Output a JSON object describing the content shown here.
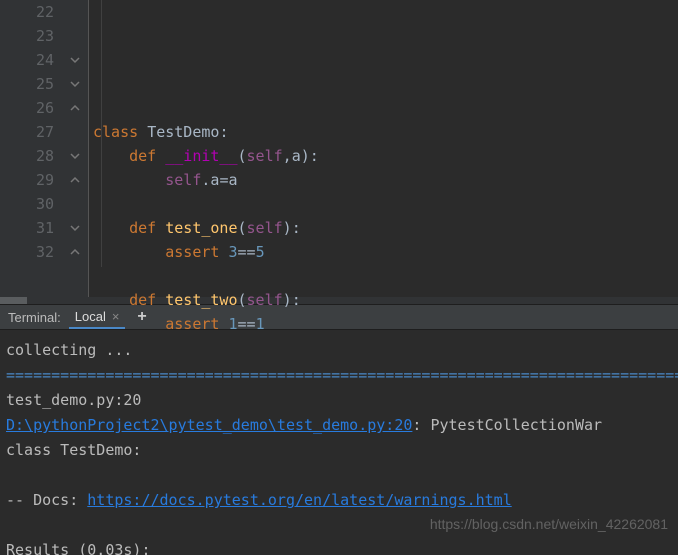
{
  "editor": {
    "lines": [
      {
        "num": 22,
        "fold": null,
        "tokens": []
      },
      {
        "num": 23,
        "fold": null,
        "tokens": []
      },
      {
        "num": 24,
        "fold": "down",
        "tokens": [
          {
            "t": "class ",
            "c": "kw-orange"
          },
          {
            "t": "TestDemo",
            "c": "punct"
          },
          {
            "t": ":",
            "c": "punct"
          }
        ]
      },
      {
        "num": 25,
        "fold": "down",
        "tokens": [
          {
            "t": "    ",
            "c": ""
          },
          {
            "t": "def ",
            "c": "kw-orange"
          },
          {
            "t": "__init__",
            "c": "fn-magic"
          },
          {
            "t": "(",
            "c": "punct"
          },
          {
            "t": "self",
            "c": "self"
          },
          {
            "t": ",",
            "c": "op"
          },
          {
            "t": "a",
            "c": "punct"
          },
          {
            "t": ")",
            "c": "punct"
          },
          {
            "t": ":",
            "c": "punct"
          }
        ]
      },
      {
        "num": 26,
        "fold": "up",
        "tokens": [
          {
            "t": "        ",
            "c": ""
          },
          {
            "t": "self",
            "c": "self"
          },
          {
            "t": ".",
            "c": "punct"
          },
          {
            "t": "a",
            "c": "punct"
          },
          {
            "t": "=",
            "c": "punct"
          },
          {
            "t": "a",
            "c": "punct"
          }
        ]
      },
      {
        "num": 27,
        "fold": null,
        "tokens": []
      },
      {
        "num": 28,
        "fold": "down",
        "tokens": [
          {
            "t": "    ",
            "c": ""
          },
          {
            "t": "def ",
            "c": "kw-orange"
          },
          {
            "t": "test_one",
            "c": "fn-yellow"
          },
          {
            "t": "(",
            "c": "punct"
          },
          {
            "t": "self",
            "c": "self"
          },
          {
            "t": ")",
            "c": "punct"
          },
          {
            "t": ":",
            "c": "punct"
          }
        ]
      },
      {
        "num": 29,
        "fold": "up",
        "tokens": [
          {
            "t": "        ",
            "c": ""
          },
          {
            "t": "assert ",
            "c": "kw-orange"
          },
          {
            "t": "3",
            "c": "kw-blue"
          },
          {
            "t": "==",
            "c": "punct"
          },
          {
            "t": "5",
            "c": "kw-blue"
          }
        ]
      },
      {
        "num": 30,
        "fold": null,
        "tokens": []
      },
      {
        "num": 31,
        "fold": "down",
        "tokens": [
          {
            "t": "    ",
            "c": ""
          },
          {
            "t": "def ",
            "c": "kw-orange"
          },
          {
            "t": "test_two",
            "c": "fn-yellow"
          },
          {
            "t": "(",
            "c": "punct"
          },
          {
            "t": "self",
            "c": "self"
          },
          {
            "t": ")",
            "c": "punct"
          },
          {
            "t": ":",
            "c": "punct"
          }
        ]
      },
      {
        "num": 32,
        "fold": "up",
        "tokens": [
          {
            "t": "        ",
            "c": ""
          },
          {
            "t": "assert ",
            "c": "kw-orange"
          },
          {
            "t": "1",
            "c": "kw-blue"
          },
          {
            "t": "==",
            "c": "punct"
          },
          {
            "t": "1",
            "c": "kw-blue"
          }
        ]
      }
    ]
  },
  "terminal": {
    "label": "Terminal:",
    "tab_name": "Local",
    "lines": {
      "collecting": "collecting ...",
      "sep": "===================================================================================",
      "loc": "test_demo.py:20",
      "path_link": "D:\\pythonProject2\\pytest_demo\\test_demo.py:20",
      "path_tail": ": PytestCollectionWar",
      "class_line": "    class TestDemo:",
      "docs_prefix": "-- Docs: ",
      "docs_link": "https://docs.pytest.org/en/latest/warnings.html",
      "results": "Results (0.03s):"
    }
  },
  "watermark": "https://blog.csdn.net/weixin_42262081"
}
